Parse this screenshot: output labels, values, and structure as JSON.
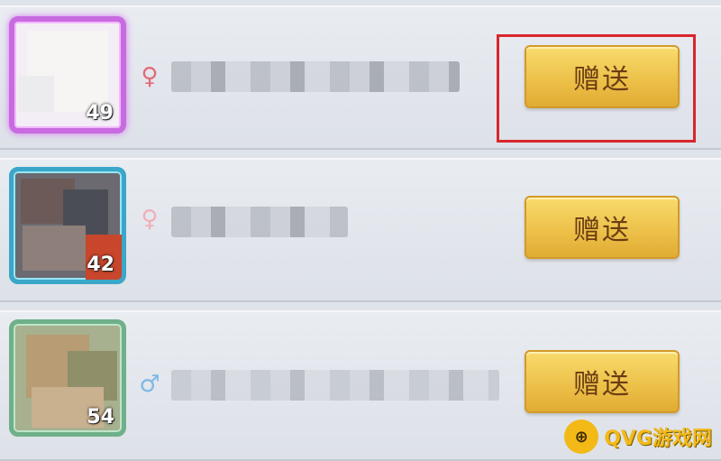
{
  "friends": [
    {
      "level": "49",
      "gift_label": "赠送",
      "highlighted": true
    },
    {
      "level": "42",
      "gift_label": "赠送",
      "highlighted": false
    },
    {
      "level": "54",
      "gift_label": "赠送",
      "highlighted": false
    }
  ],
  "icons": {
    "gender": "gender-symbol-icon",
    "watermark": "gamepad-logo-icon"
  },
  "colors": {
    "button": "#f0c44e",
    "highlight": "#d9262c",
    "watermark": "#f3b917"
  },
  "watermark": {
    "text": "QVG游戏网"
  }
}
